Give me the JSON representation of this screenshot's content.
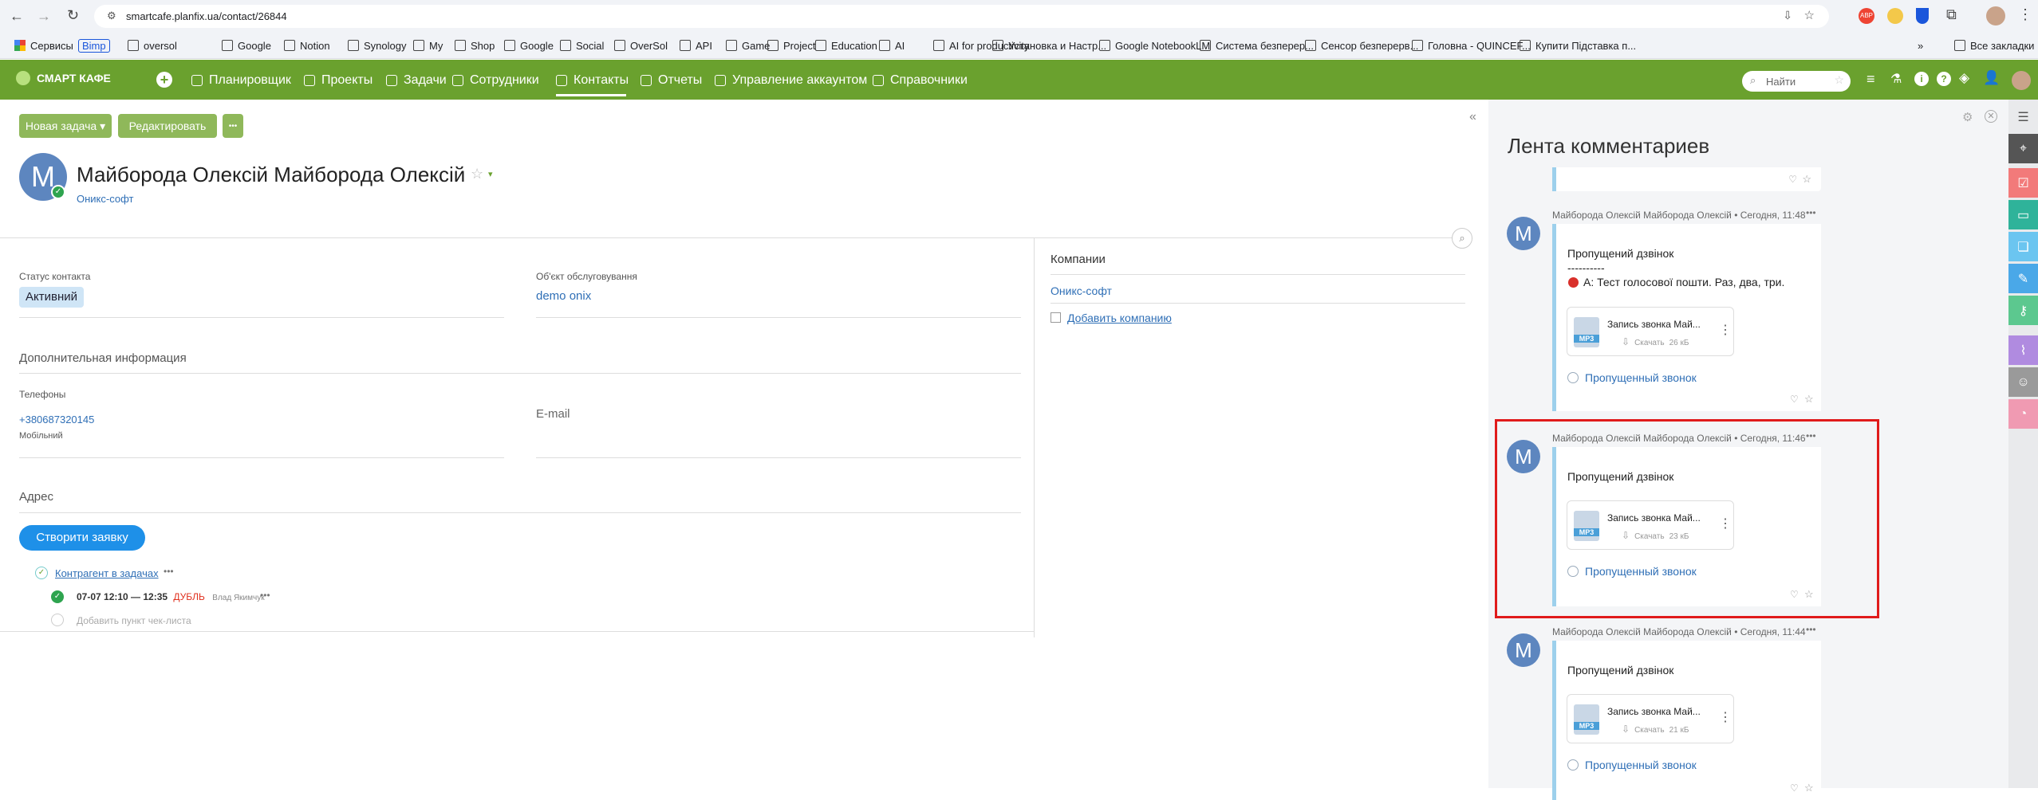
{
  "browser": {
    "url": "smartcafe.planfix.ua/contact/26844",
    "bookmarks": [
      "Сервисы",
      "Bimp",
      "oversol",
      "Google",
      "Notion",
      "Synology",
      "My",
      "Shop",
      "Google",
      "Social",
      "OverSol",
      "API",
      "Game",
      "Project",
      "Education",
      "AI",
      "AI for productivity",
      "Установка и Настр...",
      "Google NotebookLM",
      "Система безперер...",
      "Сенсор безперерв...",
      "Головна - QUINCEF...",
      "Купити Підставка п..."
    ],
    "all_bookmarks": "Все закладки"
  },
  "app": {
    "logo": "СМАРТ КАФЕ",
    "nav": [
      "Планировщик",
      "Проекты",
      "Задачи",
      "Сотрудники",
      "Контакты",
      "Отчеты",
      "Управление аккаунтом",
      "Справочники"
    ],
    "search_placeholder": "Найти"
  },
  "toolbar": {
    "new_task": "Новая задача ▾",
    "edit": "Редактировать",
    "more": "•••"
  },
  "contact": {
    "avatar_letter": "M",
    "name": "Майборода Олексій Майборода Олексій",
    "company_link": "Оникс-софт",
    "status_label": "Статус контакта",
    "status_value": "Активний",
    "service_object_label": "Об'єкт обслуговування",
    "service_object_value": "demo onix",
    "additional_info": "Дополнительная информация",
    "phones_label": "Телефоны",
    "phone": "+380687320145",
    "phone_type": "Мобільний",
    "email_label": "E-mail",
    "address_label": "Адрес",
    "create_request": "Створити заявку",
    "counterparty": "Контрагент в задачах",
    "task_time": "07-07 12:10 — 12:35",
    "task_tag": "ДУБЛЬ",
    "task_user": "Влад Якимчук",
    "add_checklist": "Добавить пункт чек-листа"
  },
  "companies": {
    "title": "Компании",
    "item": "Оникс-софт",
    "add": "Добавить компанию"
  },
  "feed": {
    "title": "Лента комментариев",
    "comments": [
      {
        "author": "Майборода Олексій Майборода Олексій • Сегодня, 11:48",
        "lines": [
          "Пропущений дзвінок",
          "----------",
          "А: Тест голосової пошти. Раз, два, три."
        ],
        "file": "Запись звонка Май...",
        "download": "Скачать",
        "size": "26 кБ",
        "missed": "Пропущенный звонок"
      },
      {
        "author": "Майборода Олексій Майборода Олексій • Сегодня, 11:46",
        "lines": [
          "Пропущений дзвінок"
        ],
        "file": "Запись звонка Май...",
        "download": "Скачать",
        "size": "23 кБ",
        "missed": "Пропущенный звонок"
      },
      {
        "author": "Майборода Олексій Майборода Олексій • Сегодня, 11:44",
        "lines": [
          "Пропущений дзвінок"
        ],
        "file": "Запись звонка Май...",
        "download": "Скачать",
        "size": "21 кБ",
        "missed": "Пропущенный звонок"
      }
    ],
    "mp3_label": "MP3"
  },
  "colors": {
    "nav_green": "#6aa12e",
    "highlight_red": "#e01b1b",
    "link_blue": "#2f6fb6"
  }
}
